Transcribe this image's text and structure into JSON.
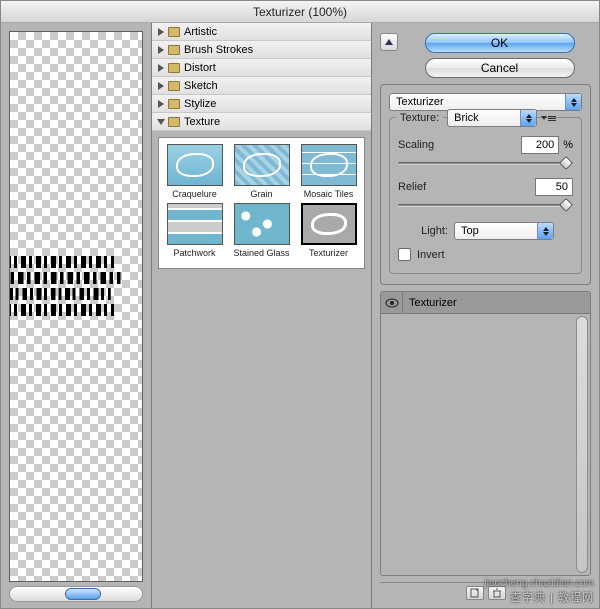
{
  "window": {
    "title": "Texturizer (100%)"
  },
  "folders": [
    {
      "label": "Artistic",
      "open": false
    },
    {
      "label": "Brush Strokes",
      "open": false
    },
    {
      "label": "Distort",
      "open": false
    },
    {
      "label": "Sketch",
      "open": false
    },
    {
      "label": "Stylize",
      "open": false
    },
    {
      "label": "Texture",
      "open": true
    }
  ],
  "thumbs": [
    {
      "label": "Craquelure",
      "cls": "tx-cra"
    },
    {
      "label": "Grain",
      "cls": "tx-gra"
    },
    {
      "label": "Mosaic Tiles",
      "cls": "tx-mos"
    },
    {
      "label": "Patchwork",
      "cls": "tx-pat"
    },
    {
      "label": "Stained Glass",
      "cls": "tx-sta"
    },
    {
      "label": "Texturizer",
      "cls": "tx-tex",
      "selected": true
    }
  ],
  "buttons": {
    "ok": "OK",
    "cancel": "Cancel"
  },
  "filter_select": {
    "value": "Texturizer"
  },
  "texture": {
    "legend": "Texture:",
    "value": "Brick",
    "scaling_label": "Scaling",
    "scaling_value": "200",
    "scaling_unit": "%",
    "relief_label": "Relief",
    "relief_value": "50",
    "light_label": "Light:",
    "light_value": "Top",
    "invert_label": "Invert",
    "invert_checked": false
  },
  "layers": {
    "item": "Texturizer"
  },
  "watermark": {
    "line1": "jiaocheng.chazidian.com",
    "line2": "查字典 | 教程网"
  }
}
